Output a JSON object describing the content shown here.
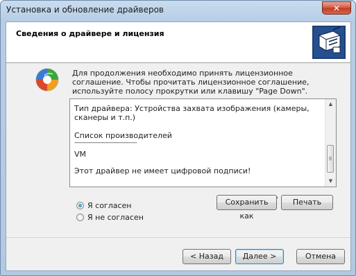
{
  "window": {
    "title": "Установка и обновление драйверов",
    "close_glyph": "✕",
    "accent_color": "#b9d1ea"
  },
  "header": {
    "title": "Сведения о драйвере и лицензия",
    "icon": "hardware-driver-icon"
  },
  "app_icon": "driver-install-wizard-icon",
  "intro_text": "Для продолжения необходимо принять лицензионное соглашение. Чтобы прочитать лицензионное соглашение, используйте полосу прокрутки или клавишу \"Page Down\".",
  "license": {
    "lines": [
      "Тип драйвера: Устройства захвата изображения (камеры, сканеры и т.п.)",
      "Список производителей",
      "----------------------------------------",
      "VM",
      "Этот драйвер не имеет цифровой подписи!"
    ],
    "annotation_color": "#e0201a"
  },
  "buttons": {
    "save_as": "Сохранить как",
    "print": "Печать",
    "back": "< Назад",
    "next": "Далее >",
    "cancel": "Отмена"
  },
  "agreement": {
    "accept_label": "Я согласен",
    "decline_label": "Я не согласен",
    "selected": "accept"
  }
}
